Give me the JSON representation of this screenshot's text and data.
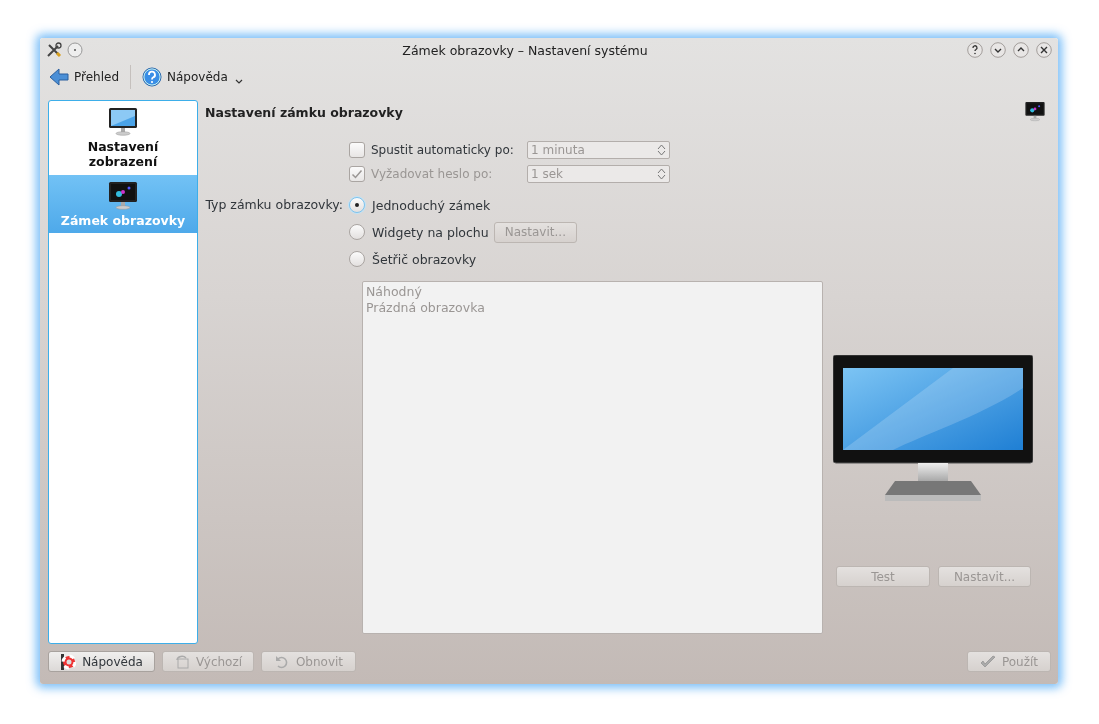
{
  "window": {
    "title": "Zámek obrazovky – Nastavení systému"
  },
  "toolbar": [
    {
      "kind": "back",
      "label": "Přehled"
    },
    {
      "kind": "help",
      "label": "Nápověda"
    }
  ],
  "sidebar": {
    "items": [
      {
        "kind": "display",
        "label": "Nastavení zobrazení",
        "selected": false
      },
      {
        "kind": "lock",
        "label": "Zámek obrazovky",
        "selected": true
      }
    ]
  },
  "page": {
    "heading": "Nastavení zámku obrazovky"
  },
  "timeouts": [
    {
      "label": "Spustit automaticky po:",
      "checked": false,
      "disabled": false,
      "value": "1 minuta"
    },
    {
      "label": "Vyžadovat heslo po:",
      "checked": true,
      "disabled": true,
      "value": "1 sek"
    }
  ],
  "lock_type": {
    "label": "Typ zámku obrazovky:",
    "options": [
      {
        "label": "Jednoduchý zámek",
        "selected": true
      },
      {
        "label": "Widgety na plochu",
        "selected": false,
        "button": {
          "label": "Nastavit...",
          "disabled": true
        }
      },
      {
        "label": "Šetřič obrazovky",
        "selected": false
      }
    ]
  },
  "screensavers": {
    "disabled": true,
    "items": [
      "Náhodný",
      "Prázdná obrazovka"
    ]
  },
  "preview": {
    "buttons": [
      {
        "label": "Test",
        "disabled": true
      },
      {
        "label": "Nastavit...",
        "disabled": true
      }
    ]
  },
  "footer": {
    "buttons": [
      {
        "kind": "help",
        "label": "Nápověda",
        "disabled": false
      },
      {
        "kind": "defaults",
        "label": "Výchozí",
        "disabled": true
      },
      {
        "kind": "reset",
        "label": "Obnovit",
        "disabled": true
      },
      {
        "kind": "apply",
        "label": "Použít",
        "disabled": true
      }
    ]
  }
}
